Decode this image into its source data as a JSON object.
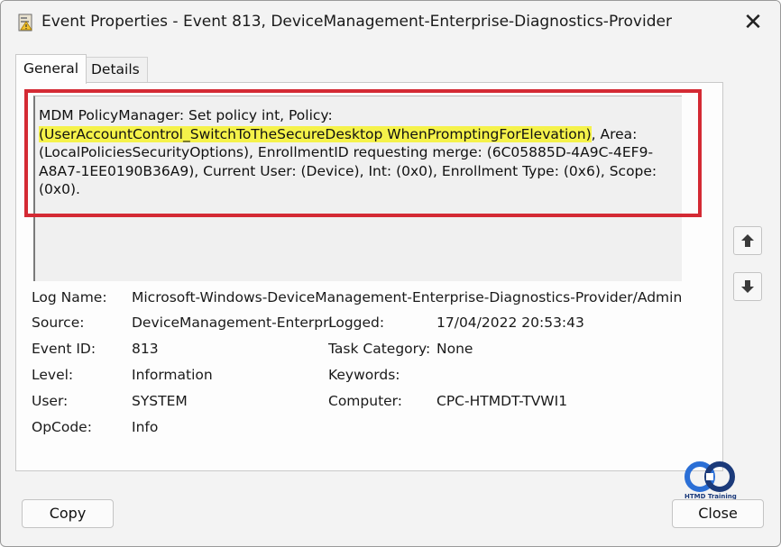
{
  "window": {
    "title": "Event Properties - Event 813, DeviceManagement-Enterprise-Diagnostics-Provider",
    "close_glyph": "✕"
  },
  "tabs": [
    {
      "label": "General",
      "active": true
    },
    {
      "label": "Details",
      "active": false
    }
  ],
  "description": {
    "part1": "MDM PolicyManager: Set policy int, Policy: ",
    "highlight": "(UserAccountControl_SwitchToTheSecureDesktop WhenPromptingForElevation)",
    "part2": ", Area: (LocalPoliciesSecurityOptions), EnrollmentID requesting merge: (6C05885D-4A9C-4EF9-A8A7-1EE0190B36A9), Current User: (Device), Int: (0x0), Enrollment Type: (0x6), Scope: (0x0).",
    "highlight_color": "#f5f24a",
    "annotation_frame_color": "#d42a34"
  },
  "fields": {
    "log_name": {
      "label": "Log Name:",
      "value": "Microsoft-Windows-DeviceManagement-Enterprise-Diagnostics-Provider/Admin"
    },
    "source": {
      "label": "Source:",
      "value": "DeviceManagement-Enterpri"
    },
    "logged": {
      "label": "Logged:",
      "value": "17/04/2022 20:53:43"
    },
    "event_id": {
      "label": "Event ID:",
      "value": "813"
    },
    "task_category": {
      "label": "Task Category:",
      "value": "None"
    },
    "level": {
      "label": "Level:",
      "value": "Information"
    },
    "keywords": {
      "label": "Keywords:",
      "value": ""
    },
    "user": {
      "label": "User:",
      "value": "SYSTEM"
    },
    "computer": {
      "label": "Computer:",
      "value": "CPC-HTMDT-TVWI1"
    },
    "opcode": {
      "label": "OpCode:",
      "value": "Info"
    }
  },
  "scroll": {
    "up_icon": "arrow-up-icon",
    "down_icon": "arrow-down-icon"
  },
  "buttons": {
    "copy": "Copy",
    "close": "Close"
  },
  "watermark": {
    "text": "HTMD Training",
    "brand_color": "#1b3a7a"
  }
}
